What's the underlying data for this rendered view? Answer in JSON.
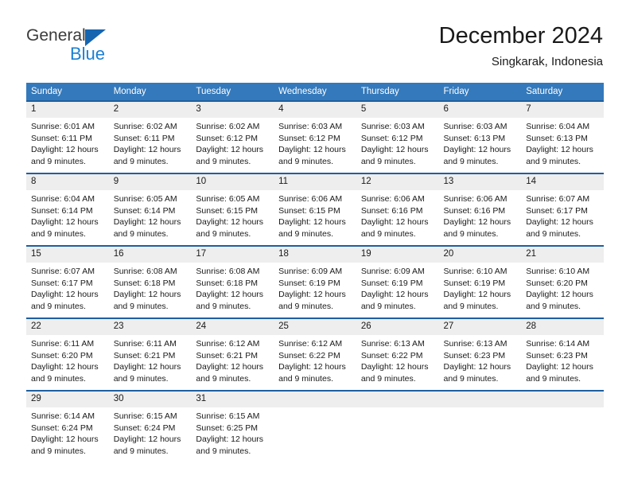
{
  "brand": {
    "name_top": "General",
    "name_bottom": "Blue",
    "triangle_color": "#1565b0",
    "accent_color": "#1a7fd4"
  },
  "header": {
    "title": "December 2024",
    "subtitle": "Singkarak, Indonesia"
  },
  "theme": {
    "header_blue": "#3479bb",
    "row_border_blue": "#1f5fa0",
    "daynum_band": "#eeeeee"
  },
  "calendar": {
    "weekday_headers": [
      "Sunday",
      "Monday",
      "Tuesday",
      "Wednesday",
      "Thursday",
      "Friday",
      "Saturday"
    ],
    "weeks": [
      [
        {
          "day": "1",
          "sunrise": "Sunrise: 6:01 AM",
          "sunset": "Sunset: 6:11 PM",
          "daylight1": "Daylight: 12 hours",
          "daylight2": "and 9 minutes."
        },
        {
          "day": "2",
          "sunrise": "Sunrise: 6:02 AM",
          "sunset": "Sunset: 6:11 PM",
          "daylight1": "Daylight: 12 hours",
          "daylight2": "and 9 minutes."
        },
        {
          "day": "3",
          "sunrise": "Sunrise: 6:02 AM",
          "sunset": "Sunset: 6:12 PM",
          "daylight1": "Daylight: 12 hours",
          "daylight2": "and 9 minutes."
        },
        {
          "day": "4",
          "sunrise": "Sunrise: 6:03 AM",
          "sunset": "Sunset: 6:12 PM",
          "daylight1": "Daylight: 12 hours",
          "daylight2": "and 9 minutes."
        },
        {
          "day": "5",
          "sunrise": "Sunrise: 6:03 AM",
          "sunset": "Sunset: 6:12 PM",
          "daylight1": "Daylight: 12 hours",
          "daylight2": "and 9 minutes."
        },
        {
          "day": "6",
          "sunrise": "Sunrise: 6:03 AM",
          "sunset": "Sunset: 6:13 PM",
          "daylight1": "Daylight: 12 hours",
          "daylight2": "and 9 minutes."
        },
        {
          "day": "7",
          "sunrise": "Sunrise: 6:04 AM",
          "sunset": "Sunset: 6:13 PM",
          "daylight1": "Daylight: 12 hours",
          "daylight2": "and 9 minutes."
        }
      ],
      [
        {
          "day": "8",
          "sunrise": "Sunrise: 6:04 AM",
          "sunset": "Sunset: 6:14 PM",
          "daylight1": "Daylight: 12 hours",
          "daylight2": "and 9 minutes."
        },
        {
          "day": "9",
          "sunrise": "Sunrise: 6:05 AM",
          "sunset": "Sunset: 6:14 PM",
          "daylight1": "Daylight: 12 hours",
          "daylight2": "and 9 minutes."
        },
        {
          "day": "10",
          "sunrise": "Sunrise: 6:05 AM",
          "sunset": "Sunset: 6:15 PM",
          "daylight1": "Daylight: 12 hours",
          "daylight2": "and 9 minutes."
        },
        {
          "day": "11",
          "sunrise": "Sunrise: 6:06 AM",
          "sunset": "Sunset: 6:15 PM",
          "daylight1": "Daylight: 12 hours",
          "daylight2": "and 9 minutes."
        },
        {
          "day": "12",
          "sunrise": "Sunrise: 6:06 AM",
          "sunset": "Sunset: 6:16 PM",
          "daylight1": "Daylight: 12 hours",
          "daylight2": "and 9 minutes."
        },
        {
          "day": "13",
          "sunrise": "Sunrise: 6:06 AM",
          "sunset": "Sunset: 6:16 PM",
          "daylight1": "Daylight: 12 hours",
          "daylight2": "and 9 minutes."
        },
        {
          "day": "14",
          "sunrise": "Sunrise: 6:07 AM",
          "sunset": "Sunset: 6:17 PM",
          "daylight1": "Daylight: 12 hours",
          "daylight2": "and 9 minutes."
        }
      ],
      [
        {
          "day": "15",
          "sunrise": "Sunrise: 6:07 AM",
          "sunset": "Sunset: 6:17 PM",
          "daylight1": "Daylight: 12 hours",
          "daylight2": "and 9 minutes."
        },
        {
          "day": "16",
          "sunrise": "Sunrise: 6:08 AM",
          "sunset": "Sunset: 6:18 PM",
          "daylight1": "Daylight: 12 hours",
          "daylight2": "and 9 minutes."
        },
        {
          "day": "17",
          "sunrise": "Sunrise: 6:08 AM",
          "sunset": "Sunset: 6:18 PM",
          "daylight1": "Daylight: 12 hours",
          "daylight2": "and 9 minutes."
        },
        {
          "day": "18",
          "sunrise": "Sunrise: 6:09 AM",
          "sunset": "Sunset: 6:19 PM",
          "daylight1": "Daylight: 12 hours",
          "daylight2": "and 9 minutes."
        },
        {
          "day": "19",
          "sunrise": "Sunrise: 6:09 AM",
          "sunset": "Sunset: 6:19 PM",
          "daylight1": "Daylight: 12 hours",
          "daylight2": "and 9 minutes."
        },
        {
          "day": "20",
          "sunrise": "Sunrise: 6:10 AM",
          "sunset": "Sunset: 6:19 PM",
          "daylight1": "Daylight: 12 hours",
          "daylight2": "and 9 minutes."
        },
        {
          "day": "21",
          "sunrise": "Sunrise: 6:10 AM",
          "sunset": "Sunset: 6:20 PM",
          "daylight1": "Daylight: 12 hours",
          "daylight2": "and 9 minutes."
        }
      ],
      [
        {
          "day": "22",
          "sunrise": "Sunrise: 6:11 AM",
          "sunset": "Sunset: 6:20 PM",
          "daylight1": "Daylight: 12 hours",
          "daylight2": "and 9 minutes."
        },
        {
          "day": "23",
          "sunrise": "Sunrise: 6:11 AM",
          "sunset": "Sunset: 6:21 PM",
          "daylight1": "Daylight: 12 hours",
          "daylight2": "and 9 minutes."
        },
        {
          "day": "24",
          "sunrise": "Sunrise: 6:12 AM",
          "sunset": "Sunset: 6:21 PM",
          "daylight1": "Daylight: 12 hours",
          "daylight2": "and 9 minutes."
        },
        {
          "day": "25",
          "sunrise": "Sunrise: 6:12 AM",
          "sunset": "Sunset: 6:22 PM",
          "daylight1": "Daylight: 12 hours",
          "daylight2": "and 9 minutes."
        },
        {
          "day": "26",
          "sunrise": "Sunrise: 6:13 AM",
          "sunset": "Sunset: 6:22 PM",
          "daylight1": "Daylight: 12 hours",
          "daylight2": "and 9 minutes."
        },
        {
          "day": "27",
          "sunrise": "Sunrise: 6:13 AM",
          "sunset": "Sunset: 6:23 PM",
          "daylight1": "Daylight: 12 hours",
          "daylight2": "and 9 minutes."
        },
        {
          "day": "28",
          "sunrise": "Sunrise: 6:14 AM",
          "sunset": "Sunset: 6:23 PM",
          "daylight1": "Daylight: 12 hours",
          "daylight2": "and 9 minutes."
        }
      ],
      [
        {
          "day": "29",
          "sunrise": "Sunrise: 6:14 AM",
          "sunset": "Sunset: 6:24 PM",
          "daylight1": "Daylight: 12 hours",
          "daylight2": "and 9 minutes."
        },
        {
          "day": "30",
          "sunrise": "Sunrise: 6:15 AM",
          "sunset": "Sunset: 6:24 PM",
          "daylight1": "Daylight: 12 hours",
          "daylight2": "and 9 minutes."
        },
        {
          "day": "31",
          "sunrise": "Sunrise: 6:15 AM",
          "sunset": "Sunset: 6:25 PM",
          "daylight1": "Daylight: 12 hours",
          "daylight2": "and 9 minutes."
        },
        {
          "day": "",
          "sunrise": "",
          "sunset": "",
          "daylight1": "",
          "daylight2": ""
        },
        {
          "day": "",
          "sunrise": "",
          "sunset": "",
          "daylight1": "",
          "daylight2": ""
        },
        {
          "day": "",
          "sunrise": "",
          "sunset": "",
          "daylight1": "",
          "daylight2": ""
        },
        {
          "day": "",
          "sunrise": "",
          "sunset": "",
          "daylight1": "",
          "daylight2": ""
        }
      ]
    ]
  }
}
